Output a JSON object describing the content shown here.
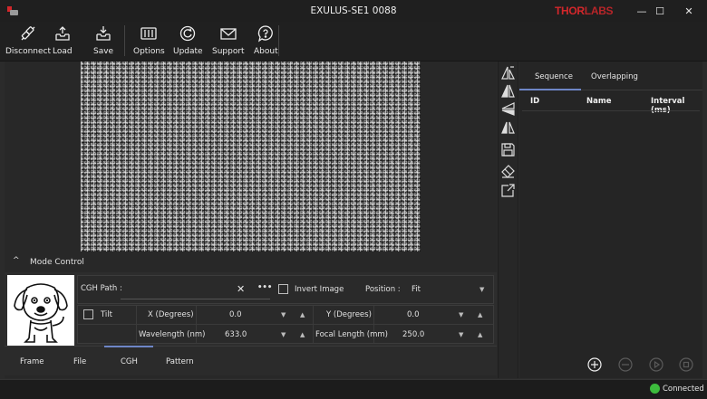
{
  "window": {
    "title": "EXULUS-SE1 0088",
    "brand_thor": "THOR",
    "brand_labs": "LABS",
    "minimize_glyph": "—",
    "maximize_glyph": "☐",
    "close_glyph": "✕"
  },
  "toolbar": {
    "disconnect": "Disconnect",
    "load": "Load",
    "save": "Save",
    "options": "Options",
    "update": "Update",
    "support": "Support",
    "about": "About"
  },
  "mode_control": {
    "header": "Mode Control",
    "chevron": "^",
    "cgh_path_label": "CGH Path :",
    "cgh_path_value": "",
    "clear_glyph": "✕",
    "browse_glyph": "•••",
    "invert_label": "Invert Image",
    "invert_checked": false,
    "position_label": "Position :",
    "position_value": "Fit",
    "tilt_label": "Tilt",
    "tilt_checked": false,
    "x_label": "X (Degrees)",
    "x_value": "0.0",
    "y_label": "Y (Degrees)",
    "y_value": "0.0",
    "wavelength_label": "Wavelength (nm)",
    "wavelength_value": "633.0",
    "focal_label": "Focal Length (mm)",
    "focal_value": "250.0"
  },
  "mode_tabs": [
    "Frame",
    "File",
    "CGH",
    "Pattern"
  ],
  "active_mode_tab": "CGH",
  "sequence": {
    "tabs": [
      "Sequence",
      "Overlapping"
    ],
    "active_tab": "Sequence",
    "columns": [
      "ID",
      "Name",
      "Interval (ms)"
    ],
    "rows": []
  },
  "status": {
    "text": "Connected",
    "color": "#3dbb3d"
  },
  "colors": {
    "accent": "#6e86c7",
    "brand": "#d3272b"
  }
}
